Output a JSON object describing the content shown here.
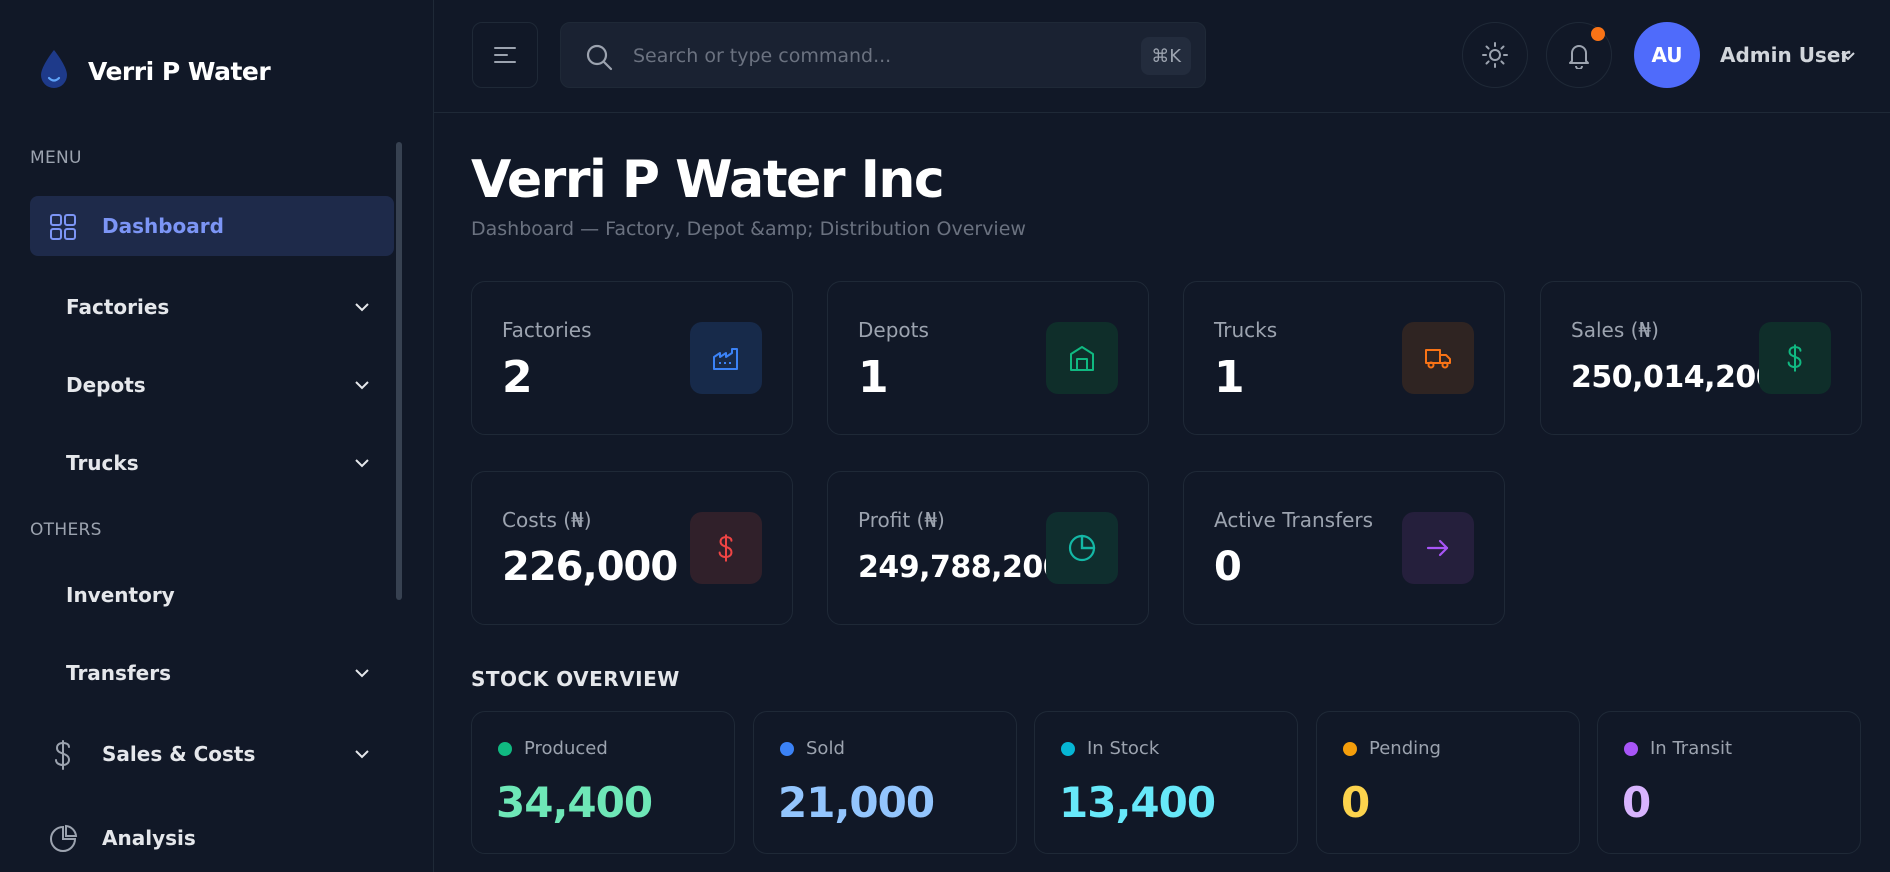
{
  "brand": {
    "name": "Verri P Water"
  },
  "sidebar": {
    "menu_heading": "MENU",
    "others_heading": "OTHERS",
    "items": [
      {
        "label": "Dashboard",
        "icon": "grid-icon",
        "active": true
      },
      {
        "label": "Factories",
        "expandable": true
      },
      {
        "label": "Depots",
        "expandable": true
      },
      {
        "label": "Trucks",
        "expandable": true
      },
      {
        "label": "Inventory"
      },
      {
        "label": "Transfers",
        "expandable": true
      },
      {
        "label": "Sales & Costs",
        "icon": "dollar-icon",
        "expandable": true
      },
      {
        "label": "Analysis",
        "icon": "pie-chart-icon"
      }
    ]
  },
  "header": {
    "search_placeholder": "Search or type command...",
    "shortcut": "⌘K",
    "user_initials": "AU",
    "user_name": "Admin User"
  },
  "page": {
    "title": "Verri P Water Inc",
    "subtitle": "Dashboard — Factory, Depot &amp; Distribution Overview"
  },
  "stats": [
    {
      "label": "Factories",
      "value": "2",
      "icon": "factory-icon",
      "accent": "#3b82f6",
      "bg": "#172a4a"
    },
    {
      "label": "Depots",
      "value": "1",
      "icon": "warehouse-icon",
      "accent": "#10b981",
      "bg": "#0f2e2a"
    },
    {
      "label": "Trucks",
      "value": "1",
      "icon": "truck-icon",
      "accent": "#f97316",
      "bg": "#2f2422"
    },
    {
      "label": "Sales (₦)",
      "value": "250,014,200",
      "icon": "dollar-icon",
      "accent": "#10b981",
      "bg": "#0f2e2a"
    },
    {
      "label": "Costs (₦)",
      "value": "226,000",
      "icon": "dollar-icon",
      "accent": "#ef4444",
      "bg": "#30202a"
    },
    {
      "label": "Profit (₦)",
      "value": "249,788,200",
      "icon": "pie-chart-icon",
      "accent": "#14b8a6",
      "bg": "#0f2e2e"
    },
    {
      "label": "Active Transfers",
      "value": "0",
      "icon": "arrow-right-icon",
      "accent": "#a855f7",
      "bg": "#251f3c"
    }
  ],
  "stock": {
    "title": "STOCK OVERVIEW",
    "items": [
      {
        "label": "Produced",
        "value": "34,400",
        "dot": "#10b981",
        "color": "#6ee7b7"
      },
      {
        "label": "Sold",
        "value": "21,000",
        "dot": "#3b82f6",
        "color": "#93c5fd"
      },
      {
        "label": "In Stock",
        "value": "13,400",
        "dot": "#06b6d4",
        "color": "#67e8f9"
      },
      {
        "label": "Pending",
        "value": "0",
        "dot": "#f59e0b",
        "color": "#fcd34d"
      },
      {
        "label": "In Transit",
        "value": "0",
        "dot": "#a855f7",
        "color": "#d8b4fe"
      }
    ]
  }
}
